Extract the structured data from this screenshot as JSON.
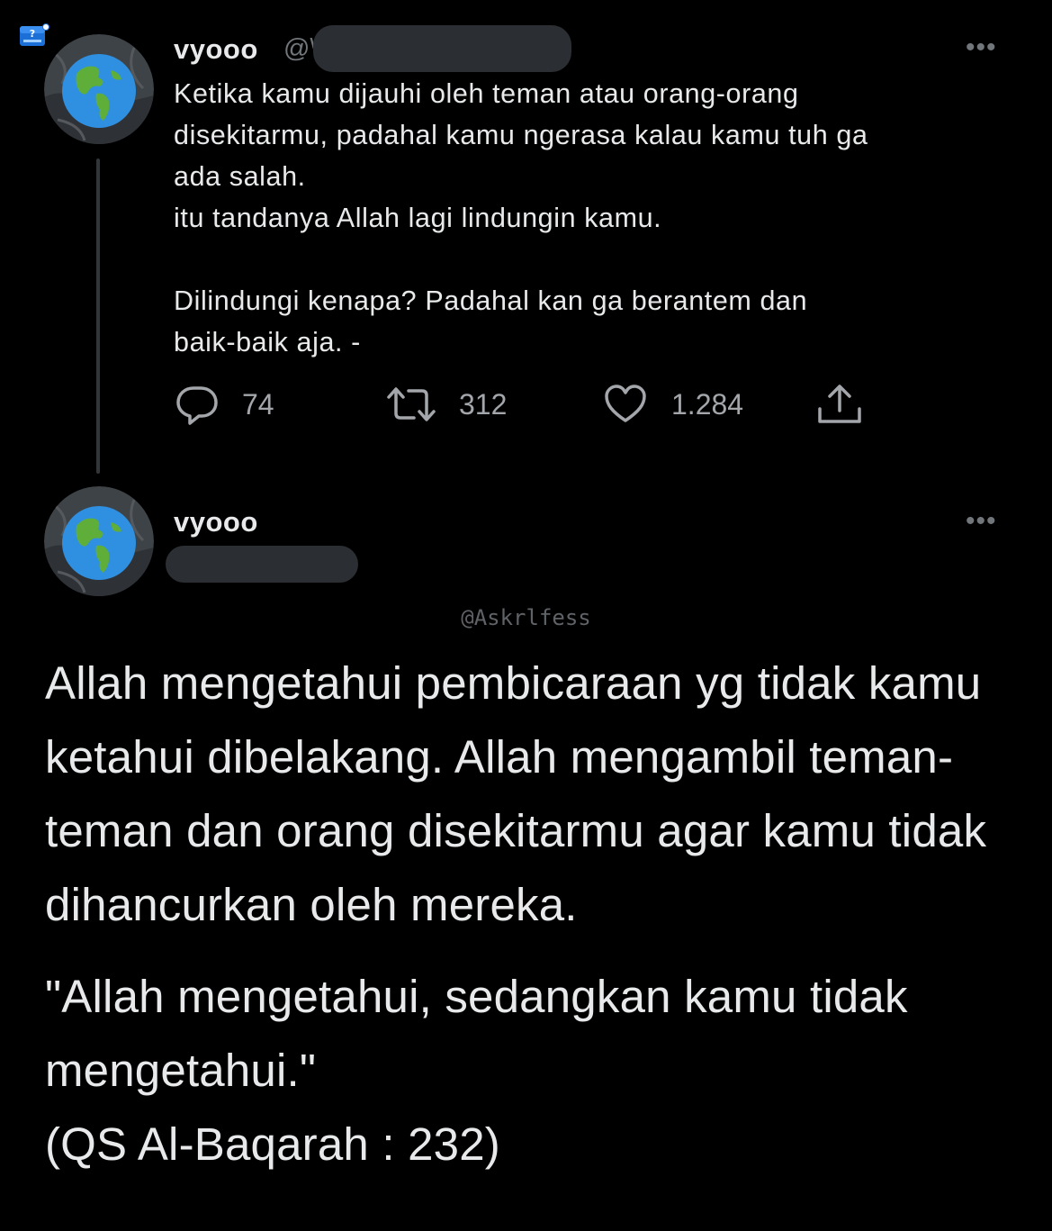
{
  "icons": {
    "corner_badge": "question-mark-badge-icon",
    "avatar": "earth-globe-icon",
    "reply": "speech-bubble-icon",
    "retweet": "retweet-arrows-icon",
    "like": "heart-icon",
    "share": "share-upload-icon",
    "more": "more-options-icon"
  },
  "colors": {
    "background": "#000000",
    "text": "#e7e9ea",
    "secondary": "#71767b",
    "redaction": "#2b2e33"
  },
  "tweet1": {
    "display_name": "vyooo",
    "handle_prefix": "@\\",
    "more": "•••",
    "text": "Ketika kamu dijauhi oleh teman atau orang-orang\ndisekitarmu, padahal kamu ngerasa kalau kamu tuh ga\nada salah.\nitu tandanya Allah lagi lindungin kamu.\n\nDilindungi kenapa? Padahal kan ga berantem dan\nbaik-baik aja. -",
    "replies": "74",
    "retweets": "312",
    "likes": "1.284"
  },
  "tweet2": {
    "display_name": "vyooo",
    "more": "•••",
    "watermark": "@Askrlfess",
    "paragraph1": "Allah mengetahui pembicaraan yg tidak kamu ketahui dibelakang. Allah mengambil teman-teman dan orang disekitarmu agar kamu tidak dihancurkan oleh mereka.",
    "quote": "\"Allah mengetahui, sedangkan kamu tidak mengetahui.\"",
    "citation": "(QS Al-Baqarah : 232)"
  }
}
